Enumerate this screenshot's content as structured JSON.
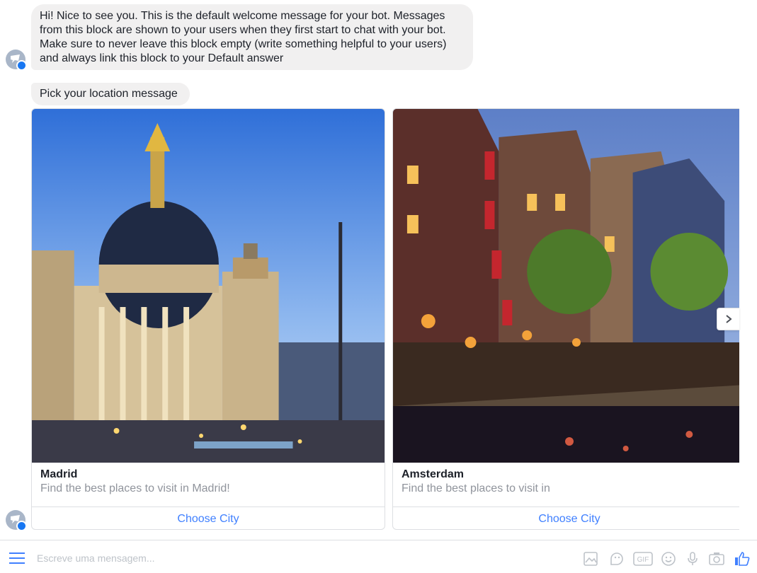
{
  "messages": {
    "welcome": "Hi! Nice to see you. This is the default welcome message for your bot. Messages from this block are shown to your users when they first start to chat with your bot. Make sure to never leave this block empty (write something helpful to your users) and always link this block to your Default answer",
    "location_prompt": "Pick your location message"
  },
  "cards": [
    {
      "title": "Madrid",
      "subtitle": "Find the best places to visit in Madrid!",
      "button": "Choose City"
    },
    {
      "title": "Amsterdam",
      "subtitle": "Find the best places to visit in",
      "button": "Choose City"
    }
  ],
  "composer": {
    "placeholder": "Escreve uma mensagem...",
    "tools": [
      "sticker-image-icon",
      "sticker-face-icon",
      "gif-icon",
      "emoji-icon",
      "microphone-icon",
      "camera-icon",
      "like-icon"
    ]
  },
  "icons": {
    "avatar": "bot-avatar-icon",
    "next": "chevron-right-icon",
    "menu": "menu-icon"
  },
  "colors": {
    "accent": "#4080ff",
    "bubble": "#f1f0f0",
    "messenger_blue": "#1877f2",
    "muted_text": "#90949c"
  }
}
